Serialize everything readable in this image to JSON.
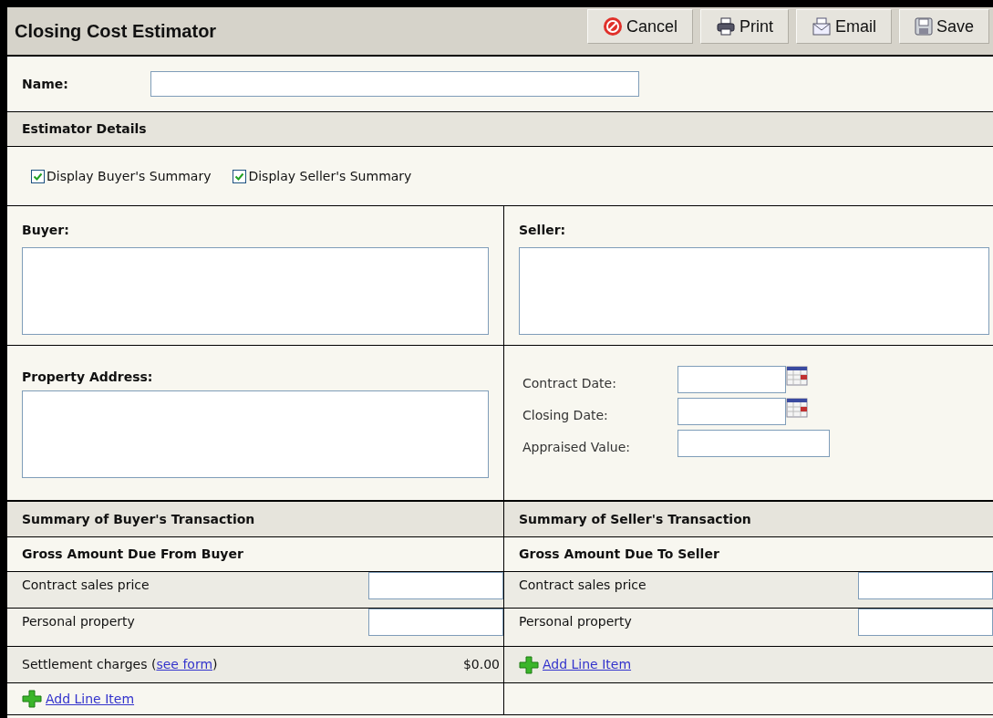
{
  "header": {
    "title": "Closing Cost Estimator",
    "buttons": [
      {
        "kind": "cancel",
        "label": "Cancel"
      },
      {
        "kind": "print",
        "label": "Print"
      },
      {
        "kind": "email",
        "label": "Email"
      },
      {
        "kind": "save",
        "label": "Save"
      }
    ]
  },
  "name": {
    "label": "Name:"
  },
  "details": {
    "title": "Estimator Details",
    "checkboxes": [
      {
        "label": "Display Buyer's Summary",
        "checked": true
      },
      {
        "label": "Display Seller's Summary",
        "checked": true
      }
    ]
  },
  "parties": [
    {
      "label": "Buyer:"
    },
    {
      "label": "Seller:"
    }
  ],
  "property": {
    "label": "Property Address:"
  },
  "dates": [
    {
      "label": "Contract Date:",
      "calendar": true
    },
    {
      "label": "Closing Date:",
      "calendar": true
    },
    {
      "label": "Appraised Value:",
      "calendar": false
    }
  ],
  "summaries": [
    {
      "title": "Summary of Buyer's Transaction",
      "subtitle": "Gross Amount Due From Buyer",
      "rows": [
        {
          "kind": "input",
          "label": "Contract sales price"
        },
        {
          "kind": "input",
          "label": "Personal property"
        },
        {
          "kind": "charges",
          "before": "Settlement charges (",
          "link": "see form",
          "after": ")",
          "amount": "$0.00"
        },
        {
          "kind": "add",
          "link": "Add Line Item"
        }
      ]
    },
    {
      "title": "Summary of Seller's Transaction",
      "subtitle": "Gross Amount Due To Seller",
      "rows": [
        {
          "kind": "input",
          "label": "Contract sales price"
        },
        {
          "kind": "input",
          "label": "Personal property"
        },
        {
          "kind": "add",
          "link": "Add Line Item"
        }
      ]
    }
  ]
}
